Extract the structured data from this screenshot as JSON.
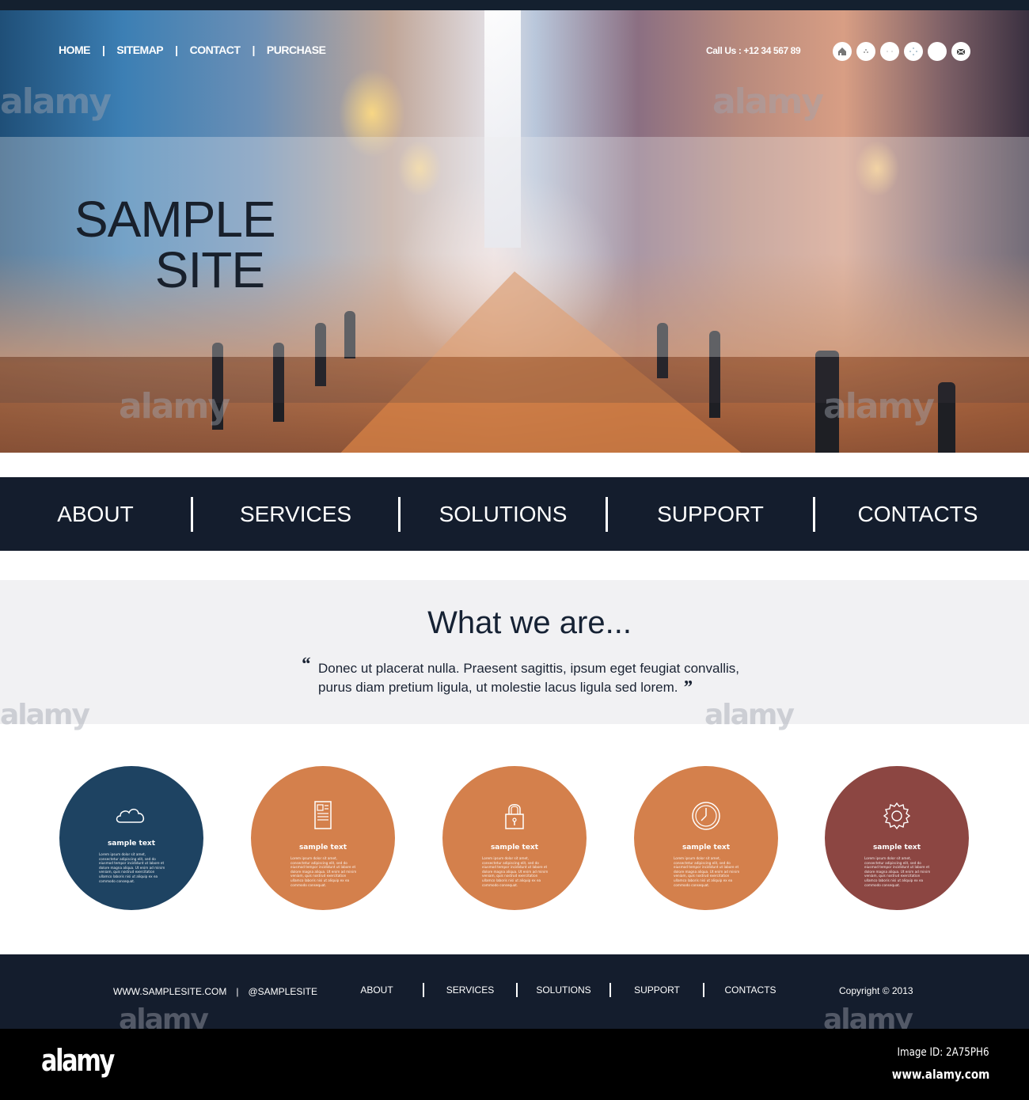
{
  "top_nav": {
    "items": [
      "HOME",
      "SITEMAP",
      "CONTACT",
      "PURCHASE"
    ],
    "separator": "|"
  },
  "contact": {
    "call_us": "Call Us : +12 34 567 89"
  },
  "social_icons": [
    "home-icon",
    "social-icon-2",
    "social-icon-3",
    "social-icon-4",
    "social-icon-5",
    "mail-icon"
  ],
  "hero": {
    "title_line1": "SAMPLE",
    "title_line2": "SITE"
  },
  "main_nav": {
    "items": [
      "ABOUT",
      "SERVICES",
      "SOLUTIONS",
      "SUPPORT",
      "CONTACTS"
    ]
  },
  "about": {
    "heading": "What we are...",
    "quote_open": "“",
    "quote_line1": "Donec ut placerat nulla. Praesent sagittis, ipsum eget feugiat convallis,",
    "quote_line2": "purus diam pretium ligula, ut molestie lacus ligula sed lorem.",
    "quote_close": "”"
  },
  "features": [
    {
      "icon": "cloud-icon",
      "title": "sample text",
      "color": "#1e4362",
      "body": "Lorem ipsum dolor sit amet, consectetur adipiscing elit, sed do eiusmod tempor incididunt ut labore et dolore magna aliqua. Ut enim ad minim veniam, quis nostrud exercitation ullamco laboris nisi ut aliquip ex ea commodo consequat."
    },
    {
      "icon": "document-icon",
      "title": "sample text",
      "color": "#d4804c",
      "body": "Lorem ipsum dolor sit amet, consectetur adipiscing elit, sed do eiusmod tempor incididunt ut labore et dolore magna aliqua. Ut enim ad minim veniam, quis nostrud exercitation ullamco laboris nisi ut aliquip ex ea commodo consequat."
    },
    {
      "icon": "lock-icon",
      "title": "sample text",
      "color": "#d4804c",
      "body": "Lorem ipsum dolor sit amet, consectetur adipiscing elit, sed do eiusmod tempor incididunt ut labore et dolore magna aliqua. Ut enim ad minim veniam, quis nostrud exercitation ullamco laboris nisi ut aliquip ex ea commodo consequat."
    },
    {
      "icon": "clock-icon",
      "title": "sample text",
      "color": "#d4804c",
      "body": "Lorem ipsum dolor sit amet, consectetur adipiscing elit, sed do eiusmod tempor incididunt ut labore et dolore magna aliqua. Ut enim ad minim veniam, quis nostrud exercitation ullamco laboris nisi ut aliquip ex ea commodo consequat."
    },
    {
      "icon": "gear-icon",
      "title": "sample text",
      "color": "#8c4642",
      "body": "Lorem ipsum dolor sit amet, consectetur adipiscing elit, sed do eiusmod tempor incididunt ut labore et dolore magna aliqua. Ut enim ad minim veniam, quis nostrud exercitation ullamco laboris nisi ut aliquip ex ea commodo consequat."
    }
  ],
  "footer": {
    "website": "WWW.SAMPLESITE.COM",
    "separator": "|",
    "handle": "@SAMPLESITE",
    "links": [
      "ABOUT",
      "SERVICES",
      "SOLUTIONS",
      "SUPPORT",
      "CONTACTS"
    ],
    "copyright": "Copyright © 2013"
  },
  "watermark": {
    "logo": "alamy",
    "image_id": "Image ID: 2A75PH6",
    "url": "www.alamy.com",
    "overlay_text": "alamy",
    "overlay_letter": "a"
  },
  "colors": {
    "navy": "#141d2d",
    "light_gray": "#f1f1f3",
    "blue_circle": "#1e4362",
    "orange_circle": "#d4804c",
    "maroon_circle": "#8c4642"
  }
}
